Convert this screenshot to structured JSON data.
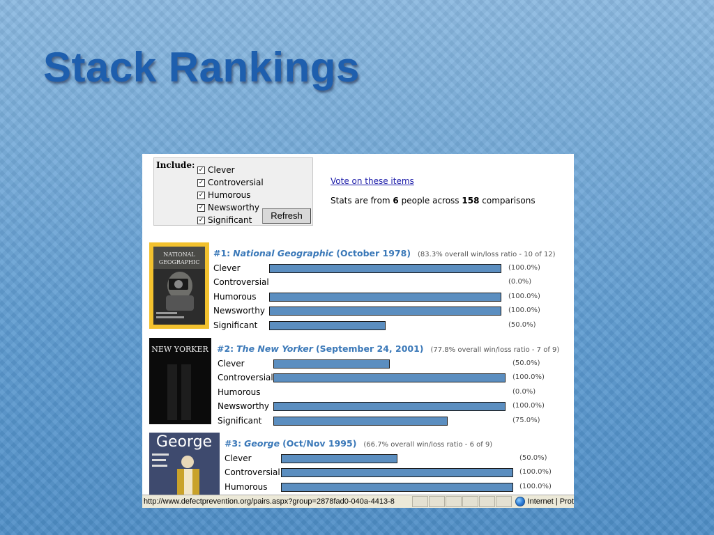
{
  "slide": {
    "title": "Stack Rankings"
  },
  "filter": {
    "include_label": "Include:",
    "check_mark": "✓",
    "options": [
      {
        "label": "Clever",
        "checked": true
      },
      {
        "label": "Controversial",
        "checked": true
      },
      {
        "label": "Humorous",
        "checked": true
      },
      {
        "label": "Newsworthy",
        "checked": true
      },
      {
        "label": "Significant",
        "checked": true
      }
    ],
    "refresh_label": "Refresh"
  },
  "summary": {
    "vote_link": "Vote on these items",
    "stats_prefix": "Stats are from ",
    "people": "6",
    "stats_middle": " people across ",
    "comparisons": "158",
    "stats_suffix": " comparisons"
  },
  "entries": [
    {
      "rank": "#1:",
      "name": "National Geographic",
      "date": "(October 1978)",
      "ratio": "(83.3% overall win/loss ratio - 10 of 12)",
      "cover_text": "NATIONAL GEOGRAPHIC",
      "scores": [
        {
          "label": "Clever",
          "value": 100.0,
          "pct": "(100.0%)"
        },
        {
          "label": "Controversial",
          "value": 0.0,
          "pct": "(0.0%)"
        },
        {
          "label": "Humorous",
          "value": 100.0,
          "pct": "(100.0%)"
        },
        {
          "label": "Newsworthy",
          "value": 100.0,
          "pct": "(100.0%)"
        },
        {
          "label": "Significant",
          "value": 50.0,
          "pct": "(50.0%)"
        }
      ]
    },
    {
      "rank": "#2:",
      "name": "The New Yorker",
      "date": "(September 24, 2001)",
      "ratio": "(77.8% overall win/loss ratio - 7 of 9)",
      "cover_text": "NEW YORKER",
      "scores": [
        {
          "label": "Clever",
          "value": 50.0,
          "pct": "(50.0%)"
        },
        {
          "label": "Controversial",
          "value": 100.0,
          "pct": "(100.0%)"
        },
        {
          "label": "Humorous",
          "value": 0.0,
          "pct": "(0.0%)"
        },
        {
          "label": "Newsworthy",
          "value": 100.0,
          "pct": "(100.0%)"
        },
        {
          "label": "Significant",
          "value": 75.0,
          "pct": "(75.0%)"
        }
      ]
    },
    {
      "rank": "#3:",
      "name": "George",
      "date": "(Oct/Nov 1995)",
      "ratio": "(66.7% overall win/loss ratio - 6 of 9)",
      "cover_text": "George",
      "scores": [
        {
          "label": "Clever",
          "value": 50.0,
          "pct": "(50.0%)"
        },
        {
          "label": "Controversial",
          "value": 100.0,
          "pct": "(100.0%)"
        },
        {
          "label": "Humorous",
          "value": 100.0,
          "pct": "(100.0%)"
        }
      ]
    }
  ],
  "status_bar": {
    "url": "http://www.defectprevention.org/pairs.aspx?group=2878fad0-040a-4413-8",
    "zone": "Internet | Prot"
  },
  "colors": {
    "bar_fill": "#5b8ec0",
    "rank_text": "#3a78b8",
    "title": "#1e5fae"
  }
}
